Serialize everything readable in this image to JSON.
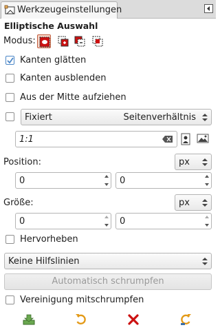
{
  "tab": {
    "title": "Werkzeugeinstellungen",
    "icon": "tool-options-icon",
    "menu_icon": "tab-menu-icon"
  },
  "panel": {
    "title": "Elliptische Auswahl"
  },
  "mode": {
    "label": "Modus:",
    "buttons": [
      {
        "name": "replace-mode-icon",
        "active": true
      },
      {
        "name": "add-mode-icon",
        "active": false
      },
      {
        "name": "subtract-mode-icon",
        "active": false
      },
      {
        "name": "intersect-mode-icon",
        "active": false
      }
    ]
  },
  "options": {
    "antialias": {
      "label": "Kanten glätten",
      "checked": true
    },
    "feather": {
      "label": "Kanten ausblenden",
      "checked": false
    },
    "expand_center": {
      "label": "Aus der Mitte aufziehen",
      "checked": false
    },
    "fixed": {
      "checked": false,
      "label": "Fixiert",
      "value": "Seitenverhältnis"
    },
    "ratio_value": "1:1",
    "highlight": {
      "label": "Hervorheben",
      "checked": false
    },
    "guides": {
      "value": "Keine Hilfslinien"
    },
    "auto_shrink": {
      "label": "Automatisch schrumpfen",
      "enabled": false
    },
    "shrink_merged": {
      "label": "Vereinigung mitschrumpfen",
      "checked": false
    }
  },
  "position": {
    "label": "Position:",
    "unit": "px",
    "x": "0",
    "y": "0"
  },
  "size": {
    "label": "Größe:",
    "unit": "px",
    "w": "0",
    "h": "0"
  },
  "footer": [
    "save-preset-icon",
    "restore-preset-icon",
    "delete-preset-icon",
    "reset-icon"
  ],
  "colors": {
    "accent": "#4a86c7",
    "danger": "#cc1111",
    "orange": "#e39a18",
    "active_bg": "#f8d6c8"
  }
}
